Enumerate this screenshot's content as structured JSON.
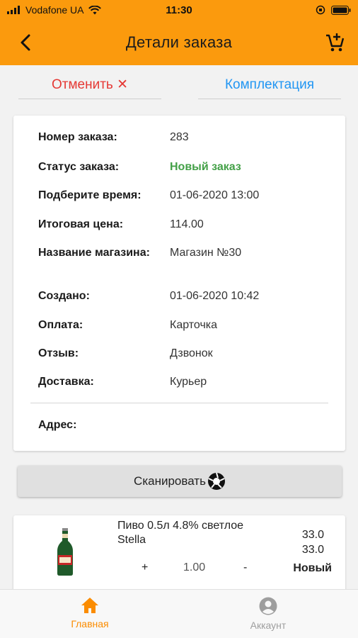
{
  "status_bar": {
    "carrier": "Vodafone UA",
    "time": "11:30"
  },
  "header": {
    "title": "Детали заказа"
  },
  "tabs": {
    "cancel": "Отменить ✕",
    "pick": "Комплектация"
  },
  "details": {
    "rows": [
      {
        "label": "Номер заказа:",
        "value": "283"
      },
      {
        "label": "Статус заказа:",
        "value": "Новый заказ"
      },
      {
        "label": "Подберите время:",
        "value": "01-06-2020 13:00"
      },
      {
        "label": "Итоговая цена:",
        "value": "114.00"
      },
      {
        "label": "Название магазина:",
        "value": "Магазин №30"
      },
      {
        "label": "Создано:",
        "value": "01-06-2020 10:42"
      },
      {
        "label": "Оплата:",
        "value": "Карточка"
      },
      {
        "label": "Отзыв:",
        "value": "Дзвонок"
      },
      {
        "label": "Доставка:",
        "value": "Курьер"
      }
    ],
    "address_label": "Адрес:",
    "status_color": "#43a047"
  },
  "scan_button": {
    "label": "Сканировать"
  },
  "product": {
    "name": "Пиво 0.5л 4.8% светлое Stella",
    "price": "33.0",
    "total": "33.0",
    "plus": "+",
    "quantity": "1.00",
    "minus": "-",
    "status": "Новый"
  },
  "nav": {
    "home": "Главная",
    "account": "Аккаунт",
    "home_icon": "home-icon",
    "account_icon": "account-circle-icon"
  },
  "colors": {
    "accent": "#fb9a0d",
    "cancel": "#e53935",
    "pick": "#2196f3"
  }
}
